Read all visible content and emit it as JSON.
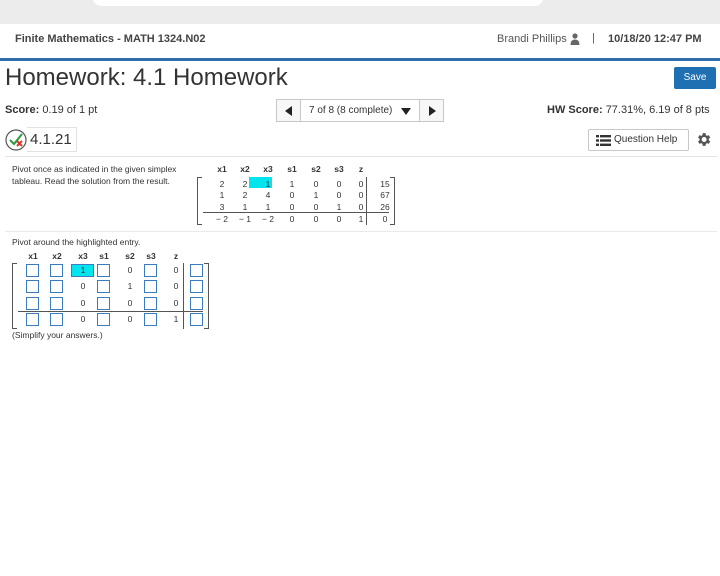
{
  "header": {
    "course": "Finite Mathematics - MATH 1324.N02",
    "user": "Brandi Phillips",
    "separator": "|",
    "datetime": "10/18/20 12:47 PM"
  },
  "homework": {
    "title": "Homework: 4.1 Homework",
    "save_label": "Save",
    "score_label": "Score:",
    "score_value": "0.19 of 1 pt",
    "pager_text": "7 of 8 (8 complete)",
    "hw_score_label": "HW Score:",
    "hw_score_value": "77.31%, 6.19 of 8 pts"
  },
  "question": {
    "number": "4.1.21",
    "help_label": "Question Help",
    "prompt": "Pivot once as indicated in the given simplex tableau. Read the solution from the result.",
    "pivot_label": "Pivot around the highlighted entry.",
    "simplify": "(Simplify your answers.)"
  },
  "tableau": {
    "headers": [
      "x1",
      "x2",
      "x3",
      "s1",
      "s2",
      "s3",
      "z"
    ],
    "rows": [
      [
        "2",
        "2",
        "1",
        "1",
        "0",
        "0",
        "0",
        "15"
      ],
      [
        "1",
        "2",
        "4",
        "0",
        "1",
        "0",
        "0",
        "67"
      ],
      [
        "3",
        "1",
        "1",
        "0",
        "0",
        "1",
        "0",
        "26"
      ],
      [
        "− 2",
        "− 1",
        "− 2",
        "0",
        "0",
        "0",
        "1",
        "0"
      ]
    ],
    "highlight": {
      "row": 0,
      "col": 2
    }
  },
  "answer": {
    "headers": [
      "x1",
      "x2",
      "x3",
      "s1",
      "s2",
      "s3",
      "z"
    ],
    "rows": [
      [
        "",
        "",
        "1",
        "",
        "0",
        "",
        "0",
        ""
      ],
      [
        "",
        "",
        "0",
        "",
        "1",
        "",
        "0",
        ""
      ],
      [
        "",
        "",
        "0",
        "",
        "0",
        "",
        "0",
        ""
      ],
      [
        "",
        "",
        "0",
        "",
        "0",
        "",
        "1",
        ""
      ]
    ]
  },
  "colors": {
    "accent": "#2f6da8",
    "save_button": "#1f6fb3",
    "highlight": "#00e5ee"
  },
  "icons": [
    "user-icon",
    "chevron-left-icon",
    "chevron-down-icon",
    "chevron-right-icon",
    "partial-credit-icon",
    "list-icon",
    "gear-icon"
  ]
}
